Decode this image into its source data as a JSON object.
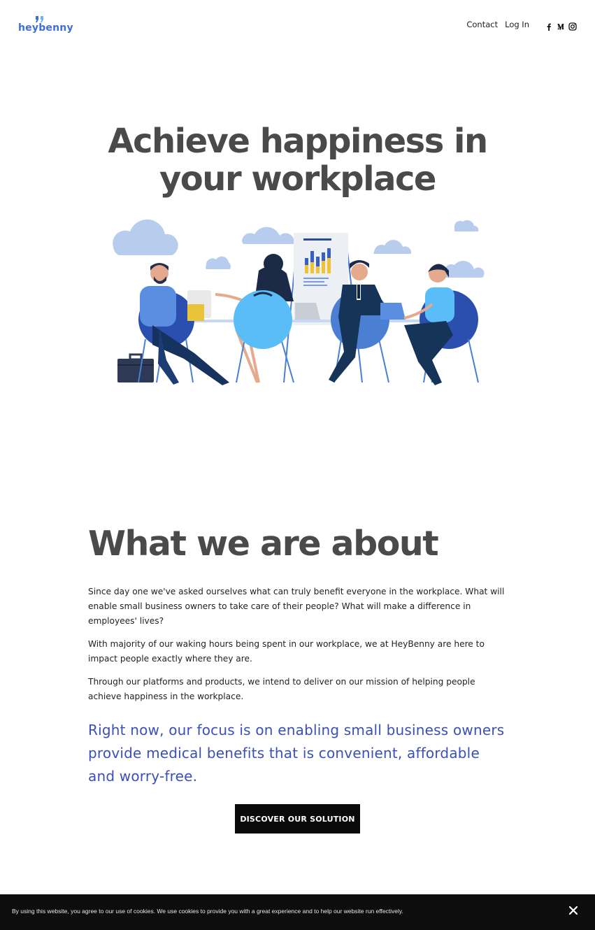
{
  "header": {
    "logo_text": "heybenny",
    "nav": {
      "contact": "Contact",
      "login": "Log In"
    },
    "social": [
      "facebook-icon",
      "medium-icon",
      "instagram-icon"
    ]
  },
  "hero": {
    "title_line1": "Achieve happiness in",
    "title_line2": "your workplace"
  },
  "about": {
    "title": "What we are about",
    "p1": "Since day one we've asked ourselves what can truly benefit everyone in the workplace. What will enable small business owners to take care of their people? What will make a difference in employees' lives?",
    "p2": "With majority of our waking hours being spent in our workplace, we at HeyBenny are here to impact people exactly where they are.",
    "p3": "Through our platforms and products, we intend to deliver on our mission of helping people achieve happiness in the workplace.",
    "focus": "Right now, our focus is on enabling small business owners provide medical benefits that is convenient, affordable and worry-free.",
    "cta": "DISCOVER OUR SOLUTION"
  },
  "cookie": {
    "text": "By using this website, you agree to our use of cookies. We use cookies to provide you with a great experience and to help our website run effectively."
  },
  "colors": {
    "brand": "#3d6fd6",
    "focus_text": "#3a50b8",
    "heading": "#4a4a4a",
    "cta_bg": "#0a0a0a"
  }
}
